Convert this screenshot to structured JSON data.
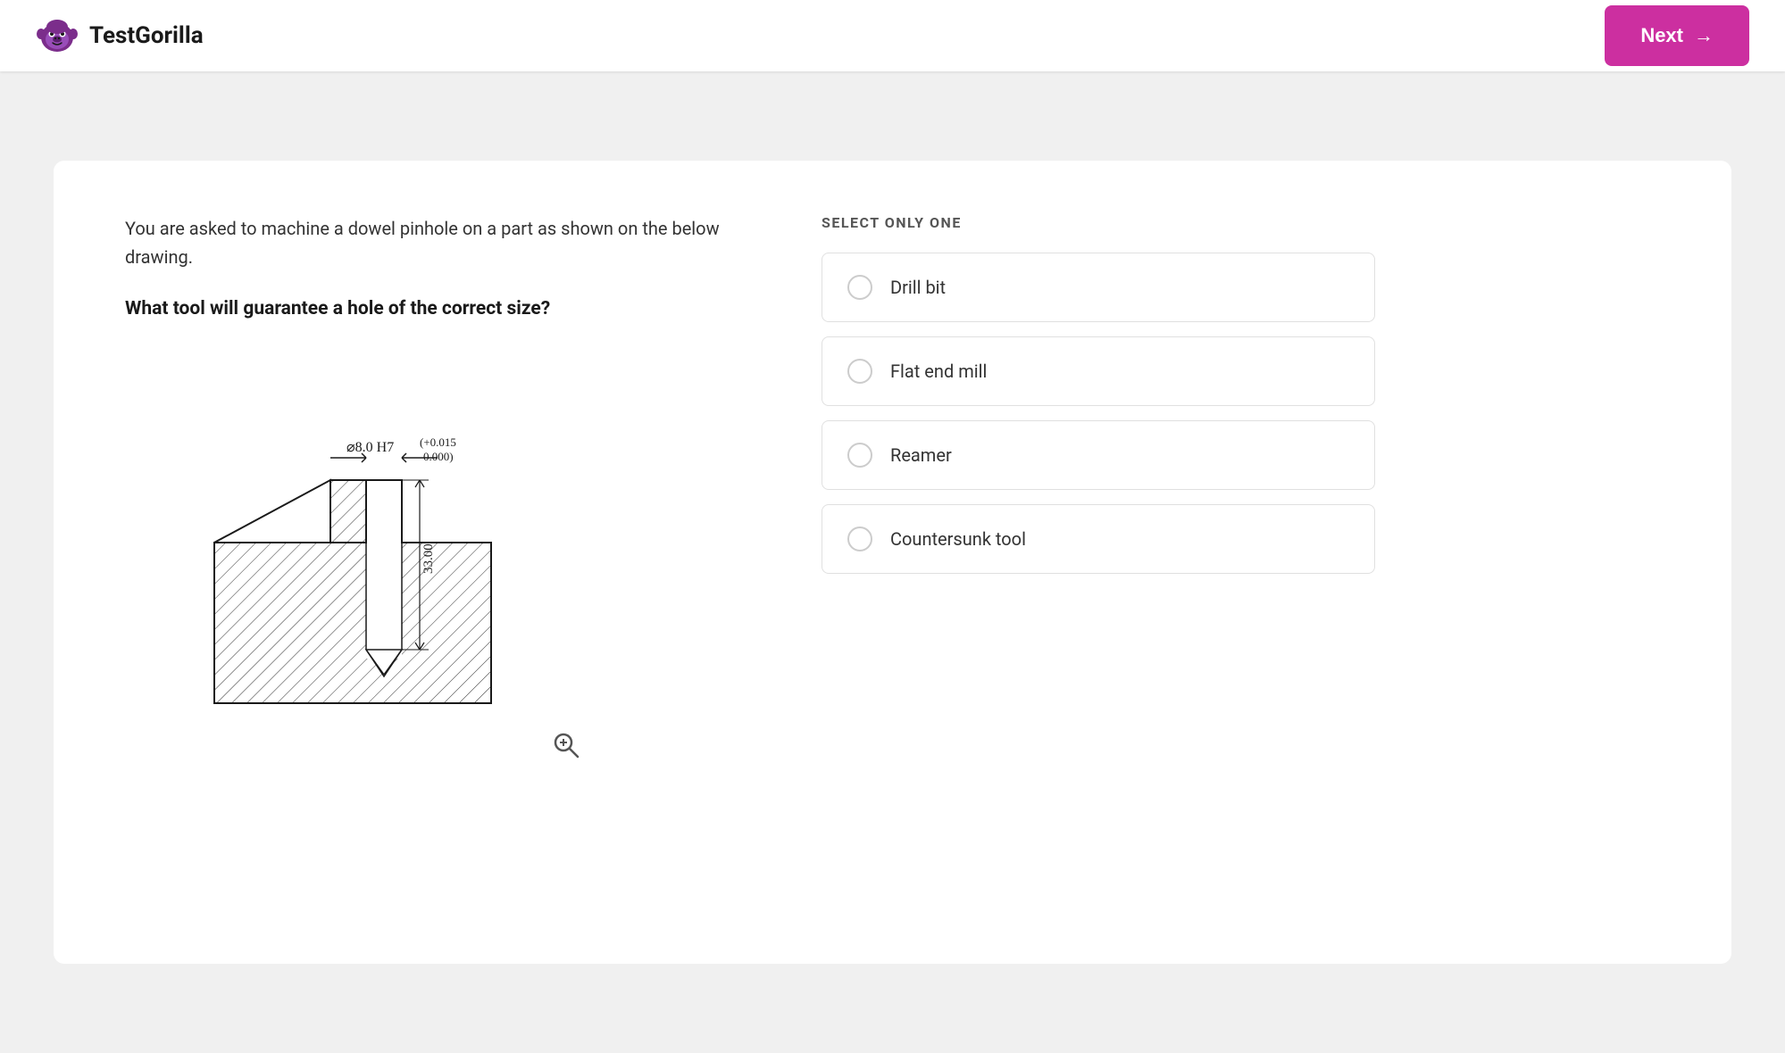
{
  "header": {
    "logo_text": "TestGorilla",
    "next_button_label": "Next",
    "next_arrow": "→"
  },
  "question": {
    "intro_text": "You are asked to machine a dowel pinhole on a part as shown on the below drawing.",
    "bold_text": "What tool will guarantee a hole of the correct size?",
    "drawing_alt": "Technical drawing showing a dowel pinhole with diameter 8.0 H7 (+0.015/0.000) and depth 33.00"
  },
  "answer_section": {
    "select_label": "SELECT ONLY ONE",
    "options": [
      {
        "id": "drill-bit",
        "label": "Drill bit"
      },
      {
        "id": "flat-end-mill",
        "label": "Flat end mill"
      },
      {
        "id": "reamer",
        "label": "Reamer"
      },
      {
        "id": "countersunk-tool",
        "label": "Countersunk tool"
      }
    ]
  },
  "colors": {
    "brand_purple": "#cc2fa0",
    "text_primary": "#1a1a1a",
    "text_secondary": "#333",
    "border_light": "#e0e0e0",
    "radio_border": "#ccc"
  }
}
